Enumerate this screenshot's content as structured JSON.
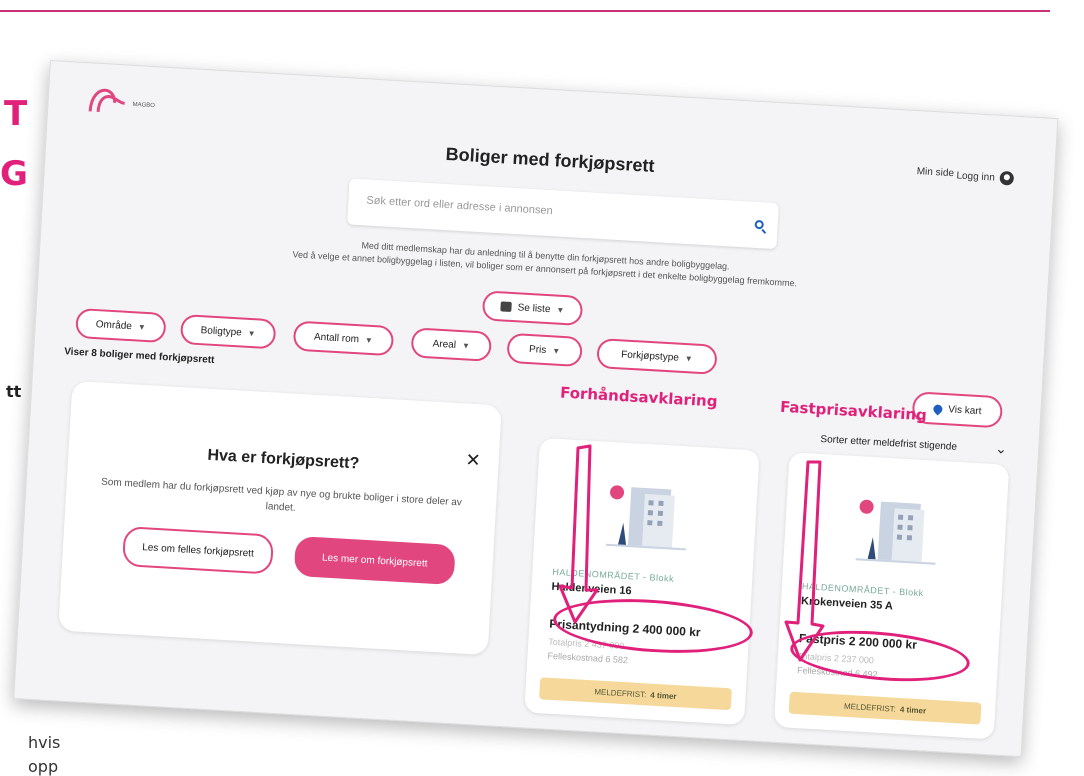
{
  "background": {
    "heading_fragment_1": "T",
    "heading_fragment_2": "G",
    "side_fragment": "tt",
    "body_fragment_1": "hvis",
    "body_fragment_2": "opp"
  },
  "header": {
    "logo_text": "MAGBO",
    "min_side": "Min side",
    "logg_inn": "Logg inn"
  },
  "page": {
    "title": "Boliger med forkjøpsrett",
    "search_placeholder": "Søk etter ord eller adresse i annonsen",
    "info_line_1": "Med ditt medlemskap har du anledning til å benytte din forkjøpsrett hos andre boligbyggelag.",
    "info_line_2": "Ved å velge et annet boligbyggelag i listen, vil boliger som er annonsert på forkjøpsrett i det enkelte boligbyggelag fremkomme.",
    "view_toggle": "Se liste"
  },
  "filters": [
    {
      "label": "Område"
    },
    {
      "label": "Boligtype"
    },
    {
      "label": "Antall rom"
    },
    {
      "label": "Areal"
    },
    {
      "label": "Pris"
    },
    {
      "label": "Forkjøpstype"
    }
  ],
  "results": {
    "count_text": "Viser 8 boliger med forkjøpsrett",
    "map_button": "Vis kart",
    "sort_text": "Sorter etter meldefrist stigende"
  },
  "info_card": {
    "title": "Hva er forkjøpsrett?",
    "body": "Som medlem har du forkjøpsrett ved kjøp av nye og brukte boliger i store deler av landet.",
    "button_outline": "Les om felles forkjøpsrett",
    "button_filled": "Les mer om forkjøpsrett"
  },
  "properties": [
    {
      "area": "HALDENOMRÅDET - Blokk",
      "address": "Haldenveien 16",
      "price": "Prisantydning 2 400 000 kr",
      "faint_line_1": "Totalpris 2 437 000",
      "faint_line_2": "Felleskostnad 6 582",
      "deadline_label": "MELDEFRIST:",
      "deadline_value": "4 timer"
    },
    {
      "area": "HALDENOMRÅDET - Blokk",
      "address": "Krokenveien 35 A",
      "price": "Fastpris 2 200 000 kr",
      "faint_line_1": "Totalpris 2 237 000",
      "faint_line_2": "Felleskostnad 6 492",
      "deadline_label": "MELDEFRIST:",
      "deadline_value": "4 timer"
    }
  ],
  "annotations": {
    "label_1": "Forhåndsavklaring",
    "label_2": "Fastprisavklaring"
  },
  "colors": {
    "accent": "#e2467f",
    "annotation": "#e0207a",
    "deadline_bg": "#f6d99a",
    "search_icon": "#1c5fbf"
  }
}
